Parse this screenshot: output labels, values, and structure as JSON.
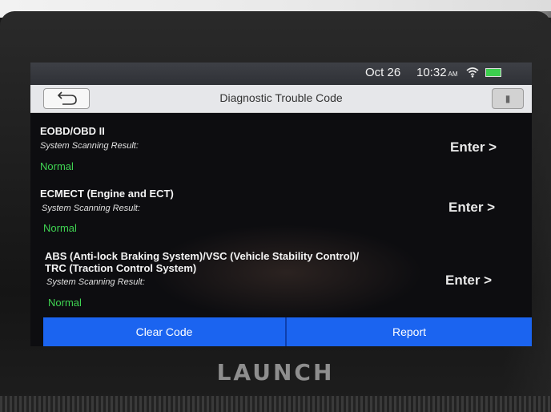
{
  "status": {
    "date": "Oct 26",
    "time": "10:32",
    "ampm": "AM"
  },
  "header": {
    "title": "Diagnostic Trouble Code"
  },
  "systems": [
    {
      "name_lines": [
        "EOBD/OBD II"
      ],
      "label": "System Scanning Result:",
      "result": "Normal",
      "action": "Enter >"
    },
    {
      "name_lines": [
        "ECMECT (Engine and ECT)"
      ],
      "label": "System Scanning Result:",
      "result": "Normal",
      "action": "Enter >"
    },
    {
      "name_lines": [
        "ABS (Anti-lock Braking System)/VSC (Vehicle Stability Control)/",
        "TRC (Traction Control System)"
      ],
      "label": "System Scanning Result:",
      "result": "Normal",
      "action": "Enter >"
    }
  ],
  "footer": {
    "clear_code": "Clear Code",
    "report": "Report"
  },
  "device": {
    "brand": "LAUNCH"
  },
  "colors": {
    "accent": "#1b64f0",
    "status_ok": "#3fd452"
  }
}
